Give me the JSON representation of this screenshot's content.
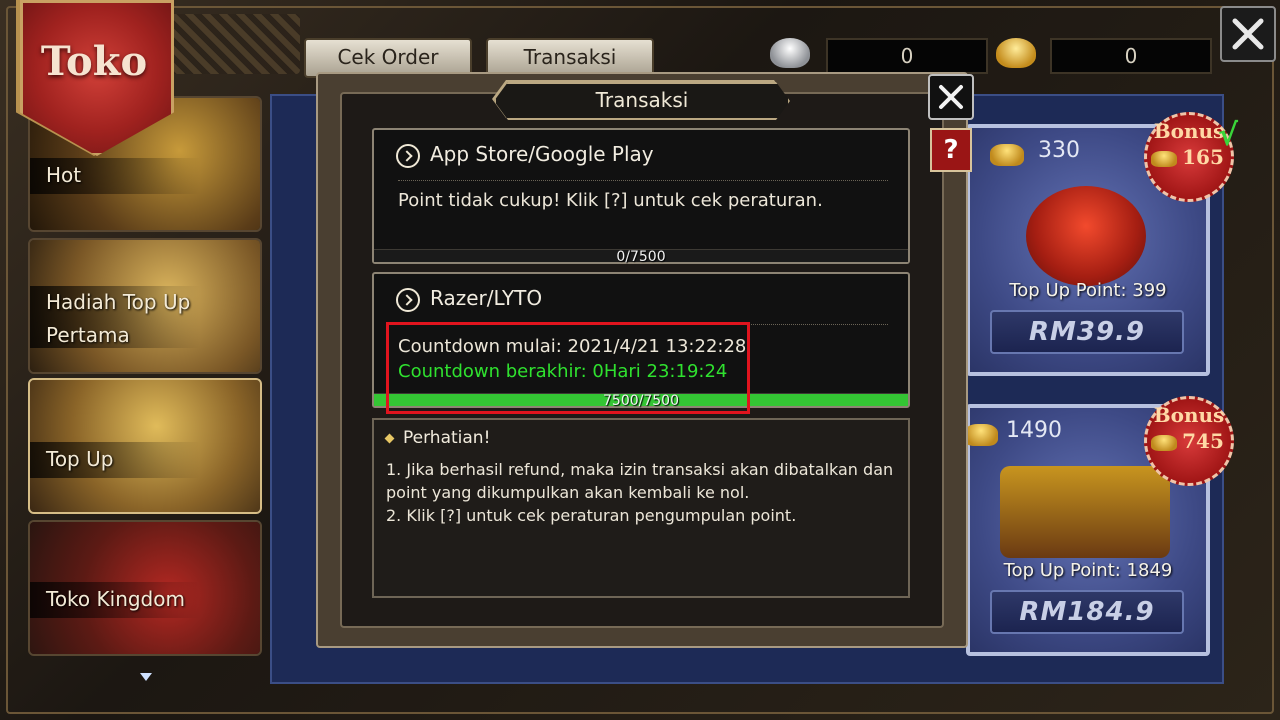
{
  "shop": {
    "title": "Toko",
    "tabs": [
      "Cek Order",
      "Transaksi"
    ],
    "currency": {
      "silver": "0",
      "gold": "0"
    }
  },
  "sidebar": {
    "items": [
      {
        "label": "Hot"
      },
      {
        "label": "Hadiah Top Up Pertama"
      },
      {
        "label": "Top Up"
      },
      {
        "label": "Toko Kingdom"
      }
    ]
  },
  "products": [
    {
      "amount": "330",
      "bonus_label": "Bonus",
      "bonus_value": "165",
      "topup_point": "Top Up Point: 399",
      "price": "RM39.9"
    },
    {
      "amount": "1490",
      "bonus_label": "Bonus",
      "bonus_value": "745",
      "topup_point": "Top Up Point: 1849",
      "price": "RM184.9"
    }
  ],
  "selected_mark": "√",
  "modal": {
    "title": "Transaksi",
    "help_label": "?",
    "sections": [
      {
        "name": "App Store/Google Play",
        "message": "Point tidak cukup! Klik [?] untuk cek peraturan.",
        "progress_text": "0/7500",
        "progress_fraction": 0
      },
      {
        "name": "Razer/LYTO",
        "countdown_start": "Countdown mulai: 2021/4/21 13:22:28",
        "countdown_end": "Countdown berakhir: 0Hari 23:19:24",
        "progress_text": "7500/7500",
        "progress_fraction": 1
      }
    ],
    "notice": {
      "title": "Perhatian!",
      "lines": [
        "1. Jika berhasil refund, maka izin transaksi akan dibatalkan dan point yang dikumpulkan akan kembali ke nol.",
        "2. Klik [?] untuk cek peraturan pengumpulan point."
      ]
    }
  },
  "colors": {
    "progress_green": "#34c534",
    "countdown_end_green": "#2fe12f",
    "highlight_red": "#e0141e",
    "panel_blue": "#1d2a56"
  }
}
